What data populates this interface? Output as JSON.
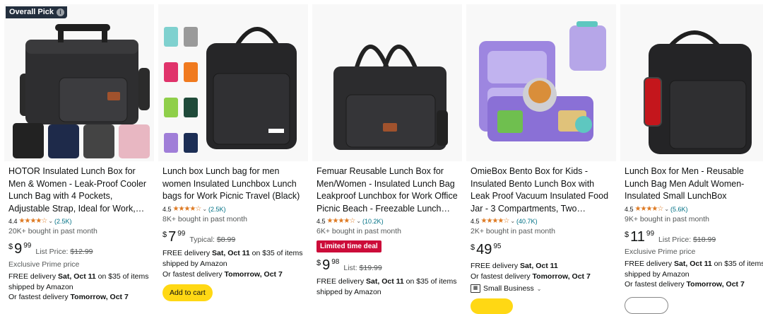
{
  "badge": {
    "label": "Overall Pick",
    "icon": "info-icon"
  },
  "products": [
    {
      "title": "HOTOR Insulated Lunch Box for Men & Women - Leak-Proof Cooler Lunch Bag with 4 Pockets, Adjustable Strap, Ideal for Work, Picnic, Travel -...",
      "rating": "4.4",
      "stars": "★★★★☆",
      "reviews": "(2.5K)",
      "bought": "20K+ bought in past month",
      "price": {
        "symbol": "$",
        "whole": "9",
        "fraction": "99",
        "label": "List Price:",
        "old": "$12.99"
      },
      "prime": "Exclusive Prime price",
      "delivery_prefix": "FREE delivery ",
      "delivery_date": "Sat, Oct 11",
      "delivery_suffix": " on $35 of items",
      "shipped": "shipped by Amazon",
      "fastest_prefix": "Or fastest delivery ",
      "fastest_date": "Tomorrow, Oct 7"
    },
    {
      "title": "Lunch box Lunch bag for men women Insulated Lunchbox Lunch bags for Work Picnic Travel (Black)",
      "rating": "4.5",
      "stars": "★★★★☆",
      "reviews": "(2.5K)",
      "bought": "8K+ bought in past month",
      "price": {
        "symbol": "$",
        "whole": "7",
        "fraction": "99",
        "label": "Typical:",
        "old": "$8.99"
      },
      "delivery_prefix": "FREE delivery ",
      "delivery_date": "Sat, Oct 11",
      "delivery_suffix": " on $35 of items",
      "shipped": "shipped by Amazon",
      "fastest_prefix": "Or fastest delivery ",
      "fastest_date": "Tomorrow, Oct 7",
      "cart": "Add to cart"
    },
    {
      "title": "Femuar Reusable Lunch Box for Men/Women - Insulated Lunch Bag Leakproof Lunchbox for Work Office Picnic Beach - Freezable Lunch Coo...",
      "rating": "4.5",
      "stars": "★★★★☆",
      "reviews": "(10.2K)",
      "bought": "6K+ bought in past month",
      "deal": "Limited time deal",
      "price": {
        "symbol": "$",
        "whole": "9",
        "fraction": "98",
        "label": "List:",
        "old": "$19.99"
      },
      "delivery_prefix": "FREE delivery ",
      "delivery_date": "Sat, Oct 11",
      "delivery_suffix": " on $35 of items",
      "shipped": "shipped by Amazon"
    },
    {
      "title": "OmieBox Bento Box for Kids - Insulated Bento Lunch Box with Leak Proof Vacuum Insulated Food Jar - 3 Compartments, Two Temperature...",
      "rating": "4.5",
      "stars": "★★★★☆",
      "reviews": "(40.7K)",
      "bought": "2K+ bought in past month",
      "price": {
        "symbol": "$",
        "whole": "49",
        "fraction": "95"
      },
      "delivery_prefix": "FREE delivery ",
      "delivery_date": "Sat, Oct 11",
      "fastest_prefix": "Or fastest delivery ",
      "fastest_date": "Tomorrow, Oct 7",
      "small_business": "Small Business"
    },
    {
      "title": "Lunch Box for Men - Reusable Lunch Bag Men Adult Women- Insulated Small LunchBox",
      "rating": "4.5",
      "stars": "★★★★☆",
      "reviews": "(5.6K)",
      "bought": "9K+ bought in past month",
      "price": {
        "symbol": "$",
        "whole": "11",
        "fraction": "99",
        "label": "List Price:",
        "old": "$18.99"
      },
      "prime": "Exclusive Prime price",
      "delivery_prefix": "FREE delivery ",
      "delivery_date": "Sat, Oct 11",
      "delivery_suffix": " on $35 of items",
      "shipped": "shipped by Amazon",
      "fastest_prefix": "Or fastest delivery ",
      "fastest_date": "Tomorrow, Oct 7"
    }
  ],
  "colors": {
    "deal_red": "#cc0c39",
    "cart_yellow": "#ffd814",
    "star_orange": "#de7921",
    "link_teal": "#007185",
    "badge_dark": "#232f3e"
  }
}
